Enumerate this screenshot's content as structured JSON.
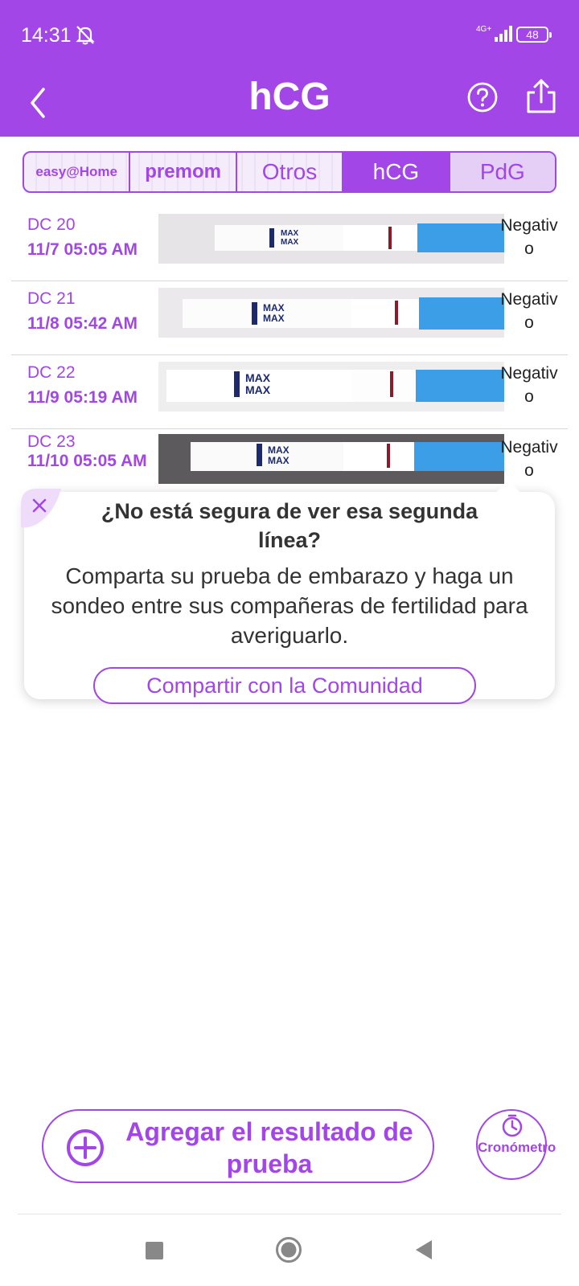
{
  "status_bar": {
    "time": "14:31",
    "network": "4G+",
    "battery": "48"
  },
  "app_bar": {
    "title": "hCG"
  },
  "tabs": [
    {
      "label": "easy@Home",
      "state": "inactive"
    },
    {
      "label": "premom",
      "state": "inactive"
    },
    {
      "label": "Otros",
      "state": "inactive"
    },
    {
      "label": "hCG",
      "state": "active"
    },
    {
      "label": "PdG",
      "state": "inactive"
    }
  ],
  "tests": [
    {
      "day": "DC 20",
      "datetime": "11/7  05:05 AM",
      "result": "Negativo",
      "strip_text": "MAX"
    },
    {
      "day": "DC 21",
      "datetime": "11/8  05:42 AM",
      "result": "Negativo",
      "strip_text": "MAX"
    },
    {
      "day": "DC 22",
      "datetime": "11/9  05:19 AM",
      "result": "Negativo",
      "strip_text": "MAX"
    },
    {
      "day": "DC 23",
      "datetime": "11/10  05:05 AM",
      "result": "Negativo",
      "strip_text": "MAX"
    }
  ],
  "popup": {
    "title": "¿No está segura de ver esa segunda línea?",
    "body": "Comparta su prueba de embarazo y haga un sondeo entre sus compañeras de fertilidad para averiguarlo.",
    "button": "Compartir con la Comunidad"
  },
  "actions": {
    "add_result": "Agregar el resultado de prueba",
    "timer": "Cronómetro"
  },
  "colors": {
    "accent": "#a346e8",
    "strip_blue": "#3d9ee8",
    "control_line": "#8b1a2a"
  }
}
